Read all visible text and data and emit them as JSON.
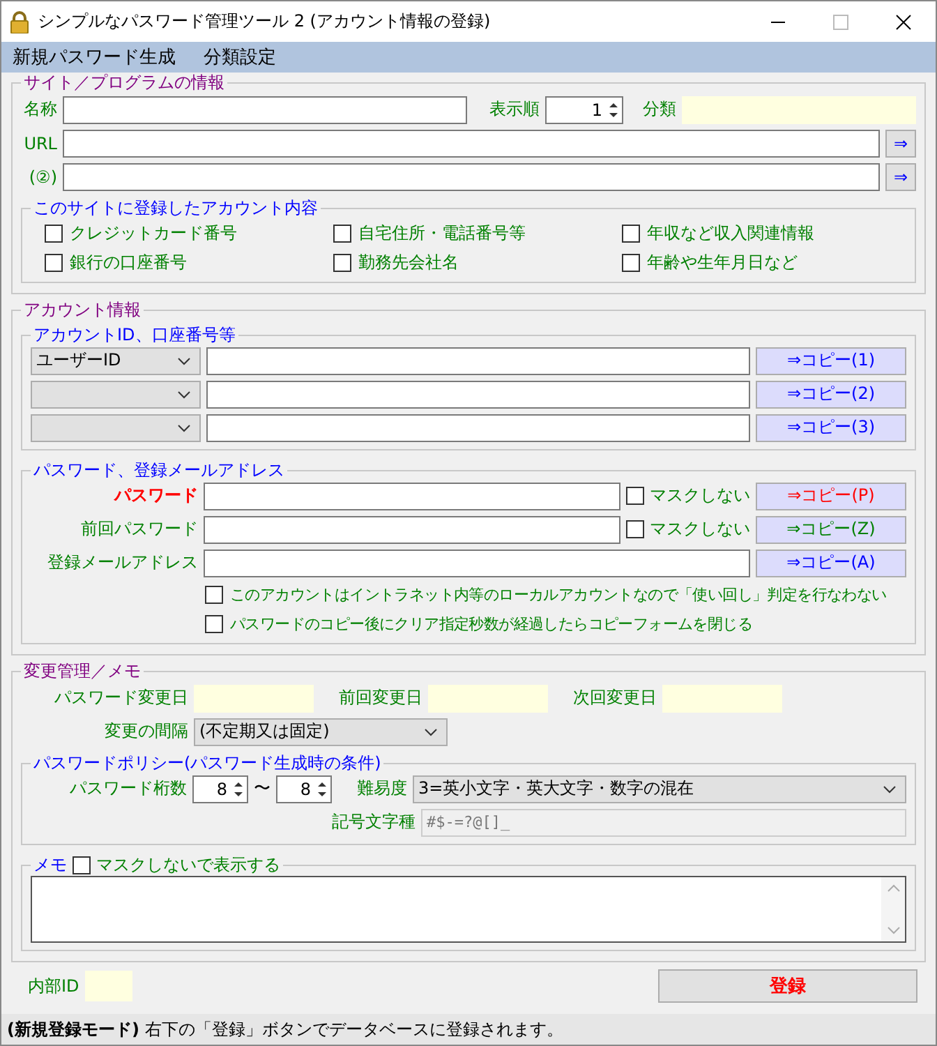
{
  "window": {
    "title": "シンプルなパスワード管理ツール 2 (アカウント情報の登録)"
  },
  "menu": [
    {
      "label": "新規パスワード生成"
    },
    {
      "label": "分類設定"
    }
  ],
  "site": {
    "legend": "サイト／プログラムの情報",
    "name_label": "名称",
    "order_label": "表示順",
    "order_value": "1",
    "category_label": "分類",
    "url_label": "URL",
    "url_button": "⇒",
    "url2_label": "(②)",
    "url2_button": "⇒",
    "content": {
      "legend": "このサイトに登録したアカウント内容",
      "checks": [
        {
          "label": "クレジットカード番号",
          "checked": false
        },
        {
          "label": "自宅住所・電話番号等",
          "checked": false
        },
        {
          "label": "年収など収入関連情報",
          "checked": false
        },
        {
          "label": "銀行の口座番号",
          "checked": false
        },
        {
          "label": "勤務先会社名",
          "checked": false
        },
        {
          "label": "年齢や生年月日など",
          "checked": false
        }
      ]
    }
  },
  "account": {
    "legend": "アカウント情報",
    "ids": {
      "legend": "アカウントID、口座番号等",
      "rows": [
        {
          "type": "ユーザーID",
          "copy": "⇒コピー(1)",
          "color": "#0000ff"
        },
        {
          "copy": "⇒コピー(2)",
          "color": "#0000ff"
        },
        {
          "copy": "⇒コピー(3)",
          "color": "#0000ff"
        }
      ]
    },
    "password": {
      "legend": "パスワード、登録メールアドレス",
      "rows": [
        {
          "kind": "primary",
          "label": "パスワード",
          "mask_label": "マスクしない",
          "mask_checked": false,
          "copy": "⇒コピー(P)",
          "color": "#ff0000"
        },
        {
          "kind": "normal",
          "label": "前回パスワード",
          "mask_label": "マスクしない",
          "mask_checked": false,
          "copy": "⇒コピー(Z)",
          "color": "#008000"
        },
        {
          "kind": "normal",
          "label": "登録メールアドレス",
          "copy": "⇒コピー(A)",
          "color": "#0000ff"
        }
      ],
      "options": [
        {
          "label": "このアカウントはイントラネット内等のローカルアカウントなので「使い回し」判定を行なわない",
          "checked": false
        },
        {
          "label": "パスワードのコピー後にクリア指定秒数が経過したらコピーフォームを閉じる",
          "checked": false
        }
      ]
    }
  },
  "change": {
    "legend": "変更管理／メモ",
    "changed_label": "パスワード変更日",
    "prev_label": "前回変更日",
    "next_label": "次回変更日",
    "interval_label": "変更の間隔",
    "interval_value": "(不定期又は固定)",
    "policy": {
      "legend": "パスワードポリシー(パスワード生成時の条件)",
      "length_label": "パスワード桁数",
      "length_min": "8",
      "tilde": "〜",
      "length_max": "8",
      "difficulty_label": "難易度",
      "difficulty_value": "3=英小文字・英大文字・数字の混在",
      "symbols_label": "記号文字種",
      "symbols_value": "#$-=?@[]_"
    },
    "memo": {
      "legend": "メモ",
      "mask_label": "マスクしないで表示する",
      "mask_checked": false
    }
  },
  "footer": {
    "id_label": "内部ID",
    "register_button": "登録"
  },
  "status_bar": {
    "text": "**(新規登録モード)** 右下の「登録」ボタンでデータベースに登録されます。"
  }
}
